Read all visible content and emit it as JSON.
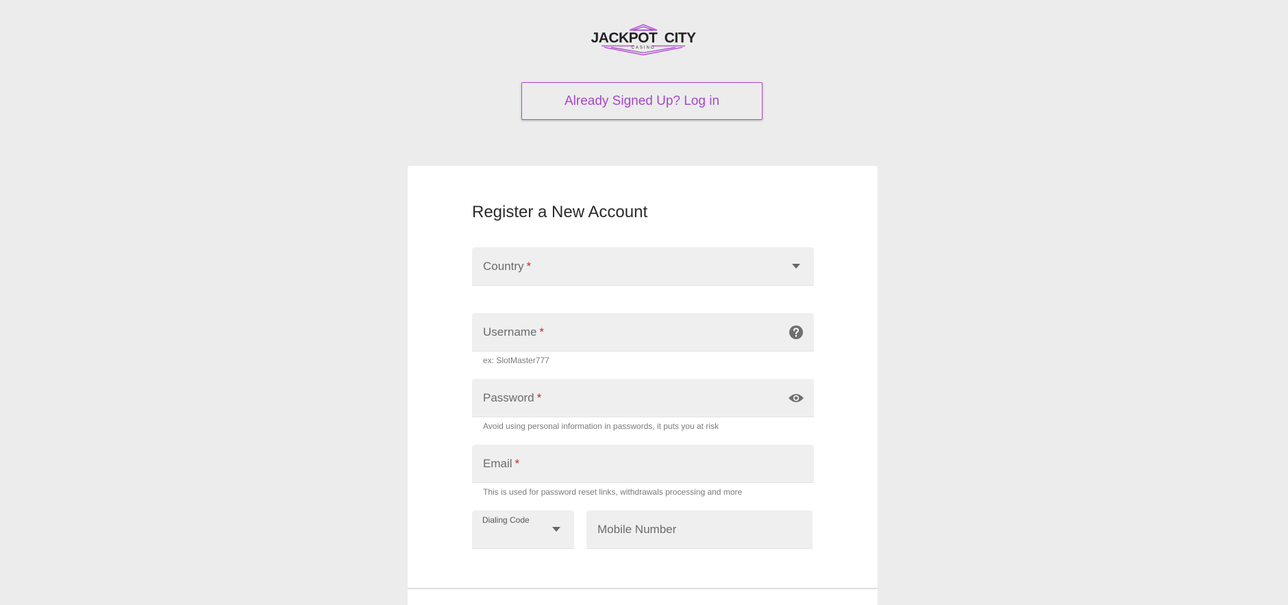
{
  "brand": {
    "logo_word1": "JACKPOT",
    "logo_word2": "CITY",
    "logo_sub": "CASINO",
    "accent": "#a448c6",
    "logo_stroke": "#c050e0"
  },
  "header": {
    "login_label": "Already Signed Up? Log in"
  },
  "form": {
    "title": "Register a New Account",
    "required_mark": "*",
    "country": {
      "label": "Country",
      "icon": "chevron-down-icon"
    },
    "username": {
      "label": "Username",
      "helper": "ex: SlotMaster777",
      "icon": "help-circle-icon"
    },
    "password": {
      "label": "Password",
      "helper": "Avoid using personal information in passwords, it puts you at risk",
      "icon": "eye-icon"
    },
    "email": {
      "label": "Email",
      "helper": "This is used for password reset links, withdrawals processing and more"
    },
    "dialing_code": {
      "label": "Dialing Code",
      "icon": "chevron-down-icon"
    },
    "mobile": {
      "label": "Mobile Number"
    }
  }
}
